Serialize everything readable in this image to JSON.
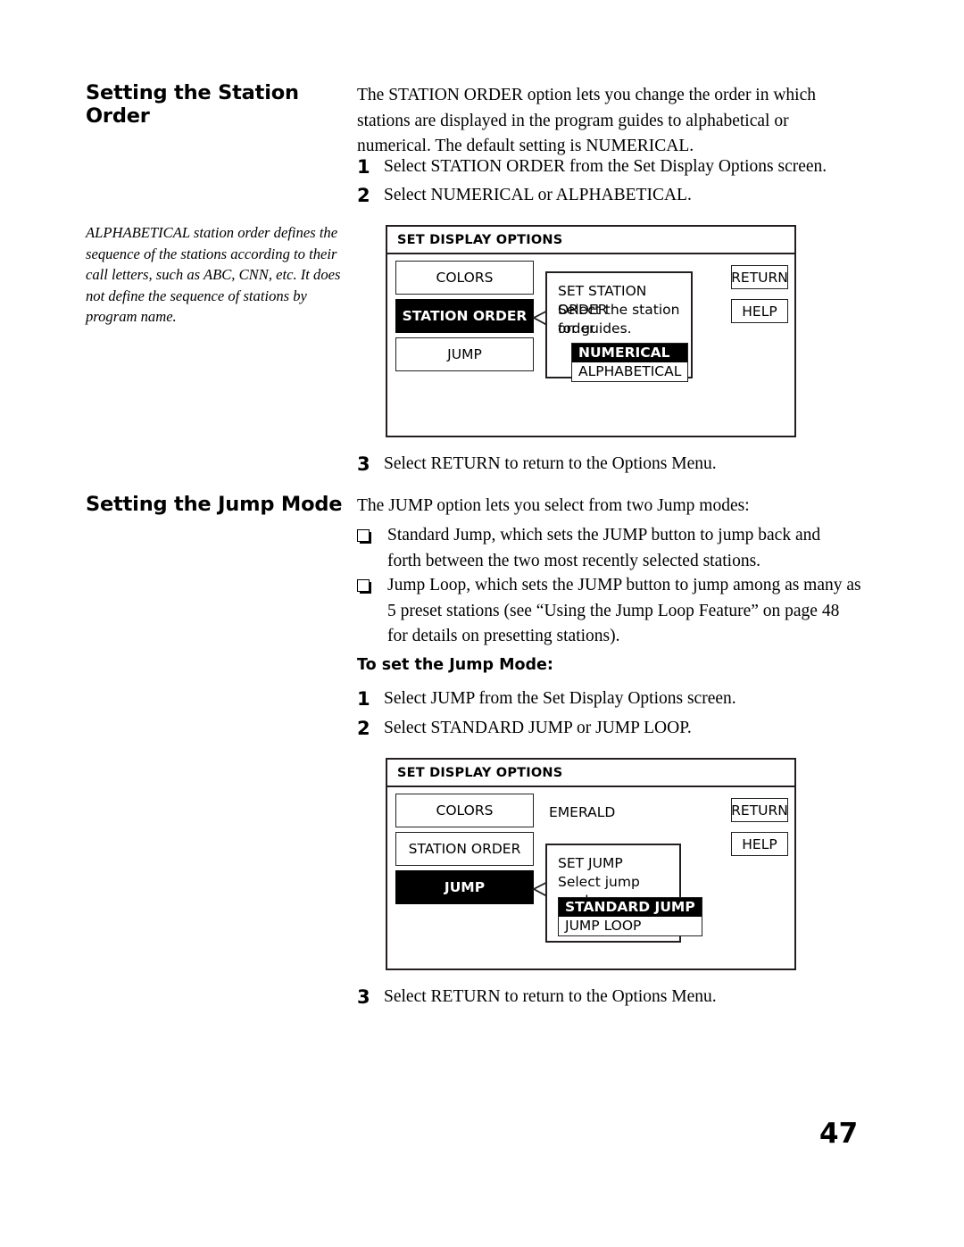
{
  "page": {
    "number": "47"
  },
  "section1": {
    "heading": "Setting the Station Order",
    "intro": "The STATION ORDER option lets you change the order in which stations are displayed in the program guides to alphabetical or numerical. The default setting is NUMERICAL.",
    "note": "ALPHABETICAL station order defines the sequence of the stations according to their call letters, such as ABC, CNN, etc. It does not define the sequence of stations by program name.",
    "steps": [
      {
        "num": "1",
        "text": "Select STATION ORDER from the Set Display Options screen."
      },
      {
        "num": "2",
        "text": "Select NUMERICAL or ALPHABETICAL."
      },
      {
        "num": "3",
        "text": "Select RETURN to return to the Options Menu."
      }
    ]
  },
  "screen1": {
    "title": "SET DISPLAY OPTIONS",
    "menu_items": [
      {
        "label": "COLORS",
        "selected": false
      },
      {
        "label": "STATION ORDER",
        "selected": true
      },
      {
        "label": "JUMP",
        "selected": false
      }
    ],
    "side_buttons": [
      {
        "label": "RETURN"
      },
      {
        "label": "HELP"
      }
    ],
    "dialog": {
      "title": "SET STATION ORDER",
      "text_line1": "Select the station order",
      "text_line2": "for guides.",
      "options": [
        {
          "label": "NUMERICAL",
          "selected": true
        },
        {
          "label": "ALPHABETICAL",
          "selected": false
        }
      ]
    }
  },
  "section2": {
    "heading": "Setting the Jump Mode",
    "intro": "The JUMP option lets you select from two Jump modes:",
    "bullets": [
      "Standard Jump, which sets the JUMP button to jump back and forth between the two most recently selected stations.",
      "Jump Loop, which sets the JUMP button to jump among as many as 5 preset stations (see “Using the Jump Loop Feature” on page 48 for details on presetting stations)."
    ],
    "subheading": "To set the Jump Mode:",
    "steps": [
      {
        "num": "1",
        "text": "Select JUMP from the Set Display Options screen."
      },
      {
        "num": "2",
        "text": "Select STANDARD JUMP or JUMP LOOP."
      },
      {
        "num": "3",
        "text": "Select RETURN to return to the Options Menu."
      }
    ]
  },
  "screen2": {
    "title": "SET DISPLAY OPTIONS",
    "menu_items": [
      {
        "label": "COLORS",
        "selected": false
      },
      {
        "label": "STATION ORDER",
        "selected": false
      },
      {
        "label": "JUMP",
        "selected": true
      }
    ],
    "color_value": "EMERALD",
    "side_buttons": [
      {
        "label": "RETURN"
      },
      {
        "label": "HELP"
      }
    ],
    "dialog": {
      "title": "SET JUMP",
      "text_line1": "Select jump mode.",
      "options": [
        {
          "label": "STANDARD JUMP",
          "selected": true
        },
        {
          "label": "JUMP LOOP",
          "selected": false
        }
      ]
    }
  }
}
